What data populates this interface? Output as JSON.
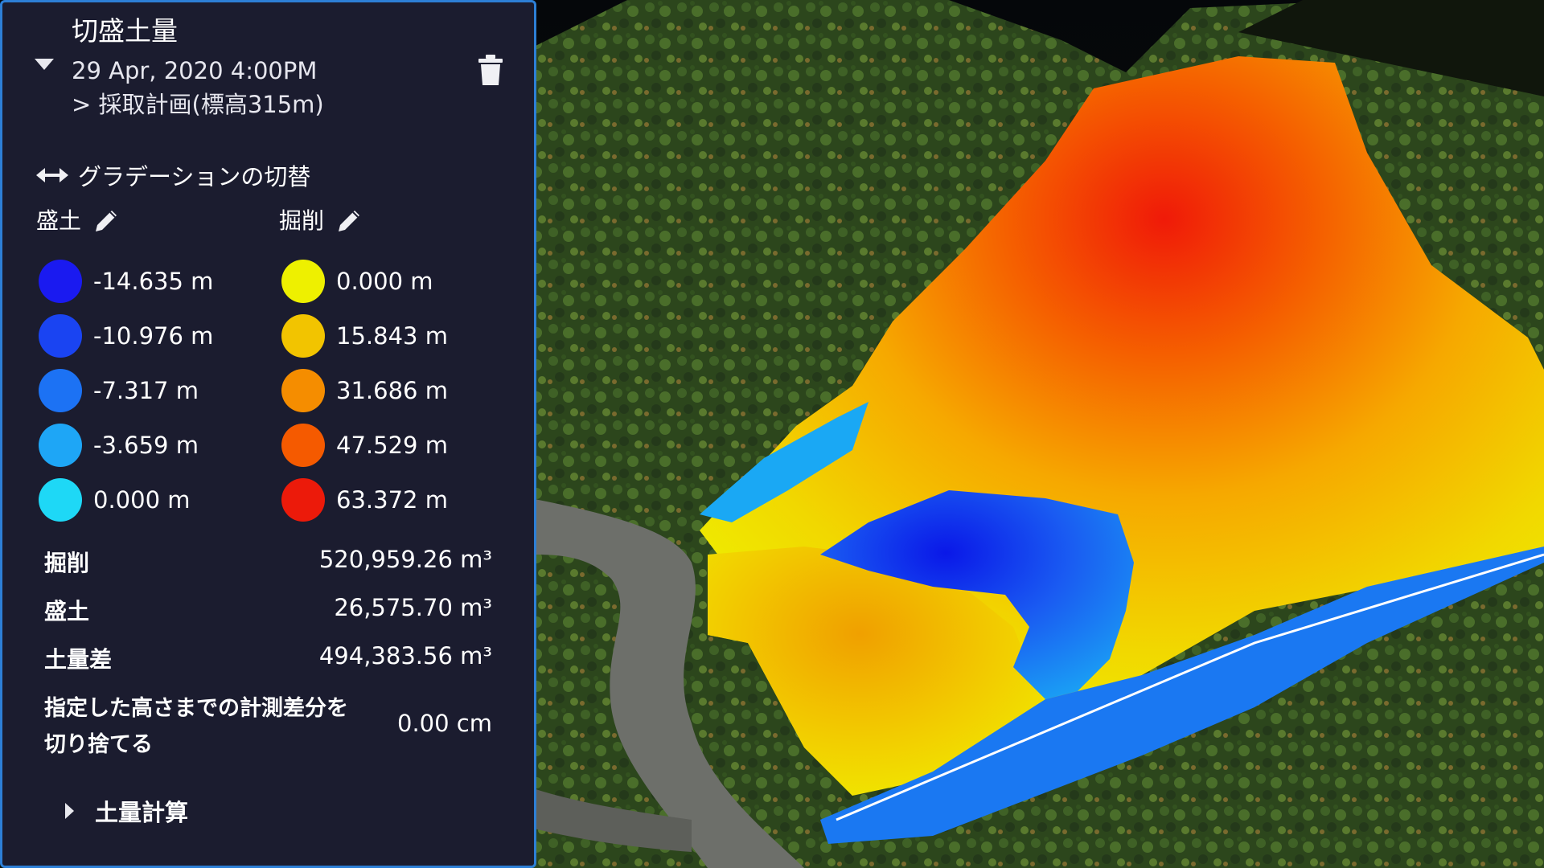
{
  "panel": {
    "title": "切盛土量",
    "date": "29 Apr, 2020 4:00PM",
    "subtitle": "> 採取計画(標高315m)",
    "gradient_toggle": "グラデーションの切替",
    "fill_header": "盛土",
    "cut_header": "掘削",
    "fill_legend": [
      {
        "label": "-14.635 m",
        "color": "#1a1af0"
      },
      {
        "label": "-10.976 m",
        "color": "#1a44f2"
      },
      {
        "label": "-7.317 m",
        "color": "#1c72f4"
      },
      {
        "label": "-3.659 m",
        "color": "#1ea6f6"
      },
      {
        "label": "0.000 m",
        "color": "#1ed8f6"
      }
    ],
    "cut_legend": [
      {
        "label": "0.000 m",
        "color": "#eef000"
      },
      {
        "label": "15.843 m",
        "color": "#f2c400"
      },
      {
        "label": "31.686 m",
        "color": "#f58d00"
      },
      {
        "label": "47.529 m",
        "color": "#f55a00"
      },
      {
        "label": "63.372 m",
        "color": "#ec1a0a"
      }
    ],
    "stats": [
      {
        "label": "掘削",
        "value": "520,959.26 m³"
      },
      {
        "label": "盛土",
        "value": "26,575.70 m³"
      },
      {
        "label": "土量差",
        "value": "494,383.56 m³"
      }
    ],
    "cutoff_label_line1": "指定した高さまでの計測差分を",
    "cutoff_label_line2": "切り捨てる",
    "cutoff_value": "0.00 cm",
    "soil_calc": "土量計算"
  },
  "colors": {
    "panel_bg": "#1b1c2f",
    "panel_border": "#2d7fd6",
    "terrain": "#2f4a1c",
    "path": "#6d6f6a"
  }
}
